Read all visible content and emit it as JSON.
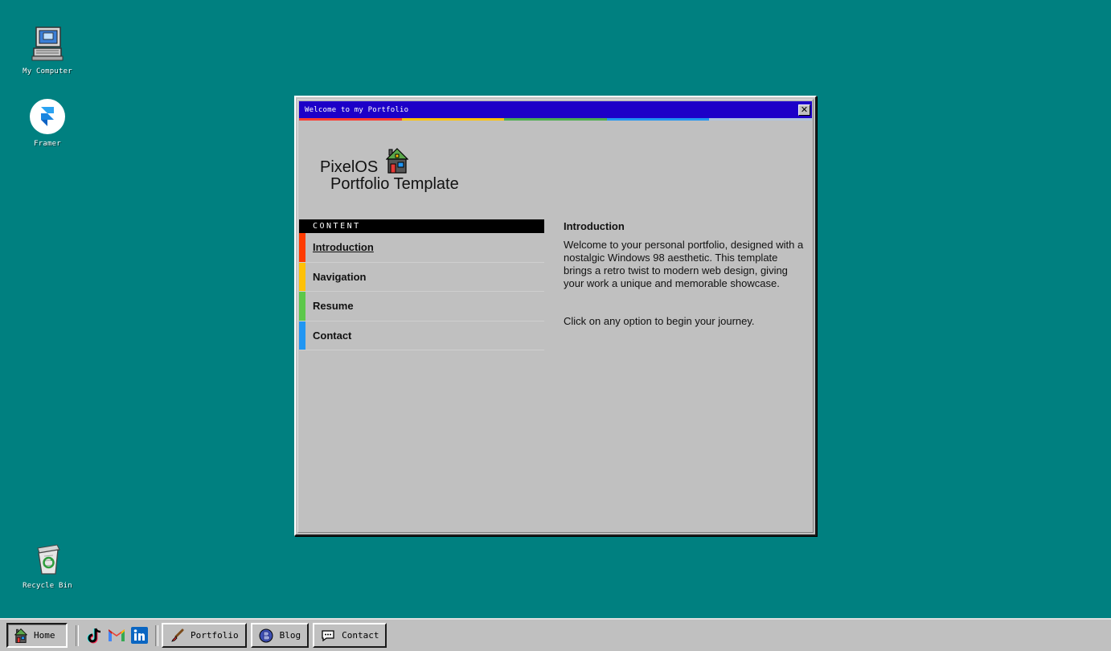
{
  "desktop": {
    "icons": [
      {
        "label": "My Computer",
        "icon": "computer-icon"
      },
      {
        "label": "Framer",
        "icon": "framer-icon"
      },
      {
        "label": "Recycle Bin",
        "icon": "recycle-bin-icon"
      }
    ]
  },
  "window": {
    "title": "Welcome to my Portfolio",
    "close_label": "✕",
    "rainbow": [
      "#ff3b30",
      "#ffc107",
      "#4caf50",
      "#2196f3",
      "#b0c4de"
    ],
    "brand_line1": "PixelOS",
    "brand_line2": "Portfolio Template",
    "content_header": "CONTENT",
    "nav": [
      {
        "label": "Introduction",
        "color": "#ff3b00"
      },
      {
        "label": "Navigation",
        "color": "#ffc107"
      },
      {
        "label": "Resume",
        "color": "#5cc84a"
      },
      {
        "label": "Contact",
        "color": "#2196f3"
      }
    ],
    "intro": {
      "heading": "Introduction",
      "para1": "Welcome to your personal portfolio, designed with a nostalgic Windows 98 aesthetic. This template brings a retro twist to modern web design, giving your work a unique and memorable showcase.",
      "para2": "Click on any option to begin your journey."
    }
  },
  "taskbar": {
    "home_label": "Home",
    "portfolio_label": "Portfolio",
    "blog_label": "Blog",
    "contact_label": "Contact",
    "social": [
      "tiktok-icon",
      "gmail-icon",
      "linkedin-icon"
    ]
  },
  "colors": {
    "desktop": "#008080",
    "titlebar": "#1d00c8",
    "window": "#c0c0c0"
  }
}
